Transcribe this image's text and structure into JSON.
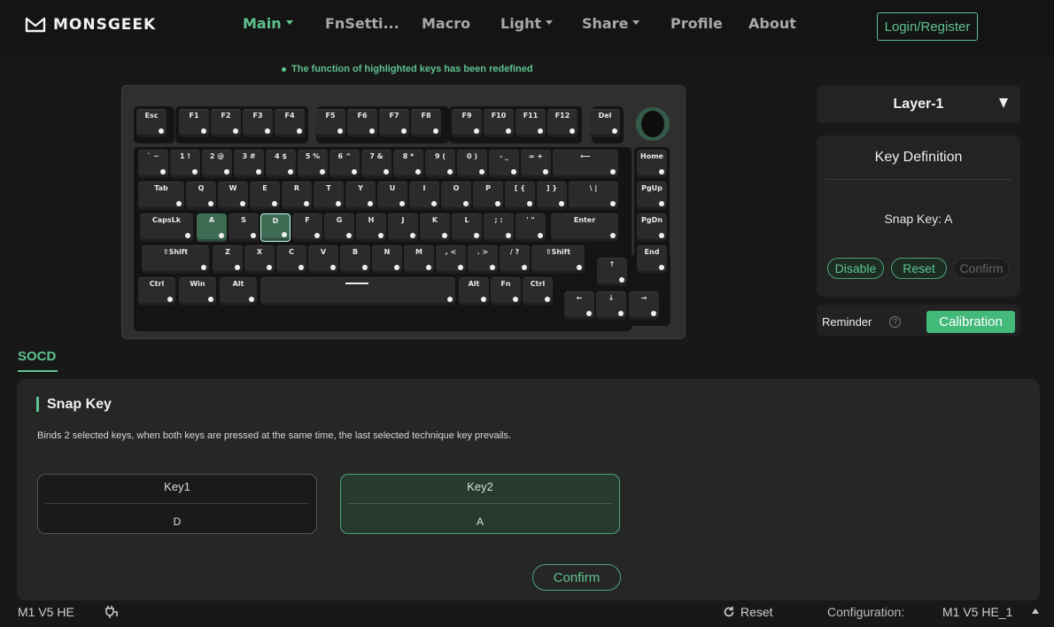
{
  "brand": {
    "name": "MONSGEEK"
  },
  "nav": {
    "items": [
      {
        "label": "Main",
        "active": true,
        "dropdown": true
      },
      {
        "label": "FnSetti...",
        "active": false,
        "dropdown": false
      },
      {
        "label": "Macro",
        "active": false,
        "dropdown": false
      },
      {
        "label": "Light",
        "active": false,
        "dropdown": true
      },
      {
        "label": "Share",
        "active": false,
        "dropdown": true
      },
      {
        "label": "Profile",
        "active": false,
        "dropdown": false
      },
      {
        "label": "About",
        "active": false,
        "dropdown": false
      }
    ],
    "login_label": "Login/Register"
  },
  "notice": "The function of highlighted keys has been redefined",
  "keyboard": {
    "rows": [
      [
        "Esc",
        "F1",
        "F2",
        "F3",
        "F4",
        "F5",
        "F6",
        "F7",
        "F8",
        "F9",
        "F10",
        "F11",
        "F12",
        "Del"
      ],
      [
        "` ~",
        "1 !",
        "2 @",
        "3 #",
        "4 $",
        "5 %",
        "6 ^",
        "7 &",
        "8 *",
        "9 (",
        "0 )",
        "- _",
        "= +",
        "⟵",
        "Home"
      ],
      [
        "Tab",
        "Q",
        "W",
        "E",
        "R",
        "T",
        "Y",
        "U",
        "I",
        "O",
        "P",
        "[ {",
        "] }",
        "\\ |",
        "PgUp"
      ],
      [
        "CapsLk",
        "A",
        "S",
        "D",
        "F",
        "G",
        "H",
        "J",
        "K",
        "L",
        "; :",
        "' \"",
        "Enter",
        "PgDn"
      ],
      [
        "⇧Shift",
        "Z",
        "X",
        "C",
        "V",
        "B",
        "N",
        "M",
        ", <",
        ". >",
        "/ ?",
        "⇧Shift",
        "↑",
        "End"
      ],
      [
        "Ctrl",
        "Win",
        "Alt",
        "",
        "Alt",
        "Fn",
        "Ctrl",
        "←",
        "↓",
        "→"
      ]
    ],
    "highlighted": [
      "A",
      "D"
    ],
    "selected": "D"
  },
  "layer": {
    "label": "Layer-1"
  },
  "key_definition": {
    "title": "Key Definition",
    "value": "Snap Key: A",
    "disable_label": "Disable",
    "reset_label": "Reset",
    "confirm_label": "Confirm"
  },
  "calibration": {
    "reminder_label": "Reminder",
    "help": "?",
    "button_label": "Calibration"
  },
  "socd": {
    "tab_label": "SOCD",
    "title": "Snap Key",
    "description": "Binds 2 selected keys, when both keys are pressed at the same time, the last selected technique key prevails.",
    "key1": {
      "title": "Key1",
      "value": "D"
    },
    "key2": {
      "title": "Key2",
      "value": "A"
    },
    "confirm_label": "Confirm"
  },
  "footer": {
    "device": "M1 V5 HE",
    "reset_label": "Reset",
    "config_label": "Configuration:",
    "config_value": "M1 V5 HE_1"
  },
  "colors": {
    "accent": "#5fc28f",
    "background": "#181818",
    "panel": "#262626",
    "highlight_key": "#3e6b54"
  }
}
